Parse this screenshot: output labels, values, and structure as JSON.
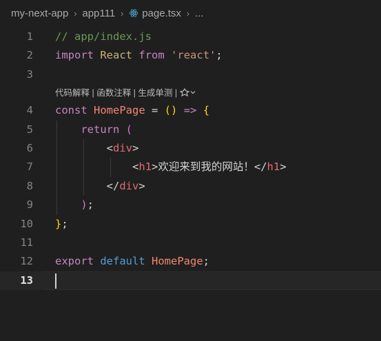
{
  "breadcrumb": {
    "items": [
      "my-next-app",
      "app111",
      "page.tsx",
      "..."
    ],
    "separator": ">"
  },
  "codelens": {
    "text": "代码解释 | 函数注释 | 生成单测 | ",
    "icon": "ai-assistant-icon",
    "chevron": "chevron-down-icon"
  },
  "editor": {
    "active_line": 13,
    "line_numbers": [
      "1",
      "2",
      "3",
      "4",
      "5",
      "6",
      "7",
      "8",
      "9",
      "10",
      "11",
      "12",
      "13"
    ],
    "lines": [
      [
        {
          "t": "// app/index.js",
          "c": "c-comment"
        }
      ],
      [
        {
          "t": "import",
          "c": "c-kw"
        },
        {
          "t": " ",
          "c": "c-text"
        },
        {
          "t": "React",
          "c": "c-react"
        },
        {
          "t": " ",
          "c": "c-text"
        },
        {
          "t": "from",
          "c": "c-kw"
        },
        {
          "t": " ",
          "c": "c-text"
        },
        {
          "t": "'react'",
          "c": "c-str"
        },
        {
          "t": ";",
          "c": "c-punc"
        }
      ],
      [],
      [
        {
          "t": "const",
          "c": "c-kw"
        },
        {
          "t": " ",
          "c": "c-text"
        },
        {
          "t": "HomePage",
          "c": "c-func"
        },
        {
          "t": " = ",
          "c": "c-punc"
        },
        {
          "t": "()",
          "c": "c-paren"
        },
        {
          "t": " ",
          "c": "c-text"
        },
        {
          "t": "=>",
          "c": "c-arrow"
        },
        {
          "t": " ",
          "c": "c-text"
        },
        {
          "t": "{",
          "c": "c-brace"
        }
      ],
      [
        {
          "t": "    ",
          "c": "c-text"
        },
        {
          "t": "return",
          "c": "c-kw"
        },
        {
          "t": " ",
          "c": "c-text"
        },
        {
          "t": "(",
          "c": "c-paren2"
        }
      ],
      [
        {
          "t": "        ",
          "c": "c-text"
        },
        {
          "t": "<",
          "c": "c-punc"
        },
        {
          "t": "div",
          "c": "c-tag"
        },
        {
          "t": ">",
          "c": "c-punc"
        }
      ],
      [
        {
          "t": "            ",
          "c": "c-text"
        },
        {
          "t": "<",
          "c": "c-punc"
        },
        {
          "t": "h1",
          "c": "c-tag"
        },
        {
          "t": ">",
          "c": "c-punc"
        },
        {
          "t": "欢迎来到我的网站！",
          "c": "c-text"
        },
        {
          "t": "</",
          "c": "c-punc"
        },
        {
          "t": "h1",
          "c": "c-tag"
        },
        {
          "t": ">",
          "c": "c-punc"
        }
      ],
      [
        {
          "t": "        ",
          "c": "c-text"
        },
        {
          "t": "</",
          "c": "c-punc"
        },
        {
          "t": "div",
          "c": "c-tag"
        },
        {
          "t": ">",
          "c": "c-punc"
        }
      ],
      [
        {
          "t": "    ",
          "c": "c-text"
        },
        {
          "t": ")",
          "c": "c-paren2"
        },
        {
          "t": ";",
          "c": "c-punc"
        }
      ],
      [
        {
          "t": "}",
          "c": "c-brace"
        },
        {
          "t": ";",
          "c": "c-punc"
        }
      ],
      [],
      [
        {
          "t": "export",
          "c": "c-kw"
        },
        {
          "t": " ",
          "c": "c-text"
        },
        {
          "t": "default",
          "c": "c-kw2"
        },
        {
          "t": " ",
          "c": "c-text"
        },
        {
          "t": "HomePage",
          "c": "c-func"
        },
        {
          "t": ";",
          "c": "c-punc"
        }
      ],
      []
    ]
  },
  "colors": {
    "background": "#1f1f1f",
    "current_line": "#262626",
    "line_number": "#858585",
    "line_number_active": "#e6e6e6"
  }
}
